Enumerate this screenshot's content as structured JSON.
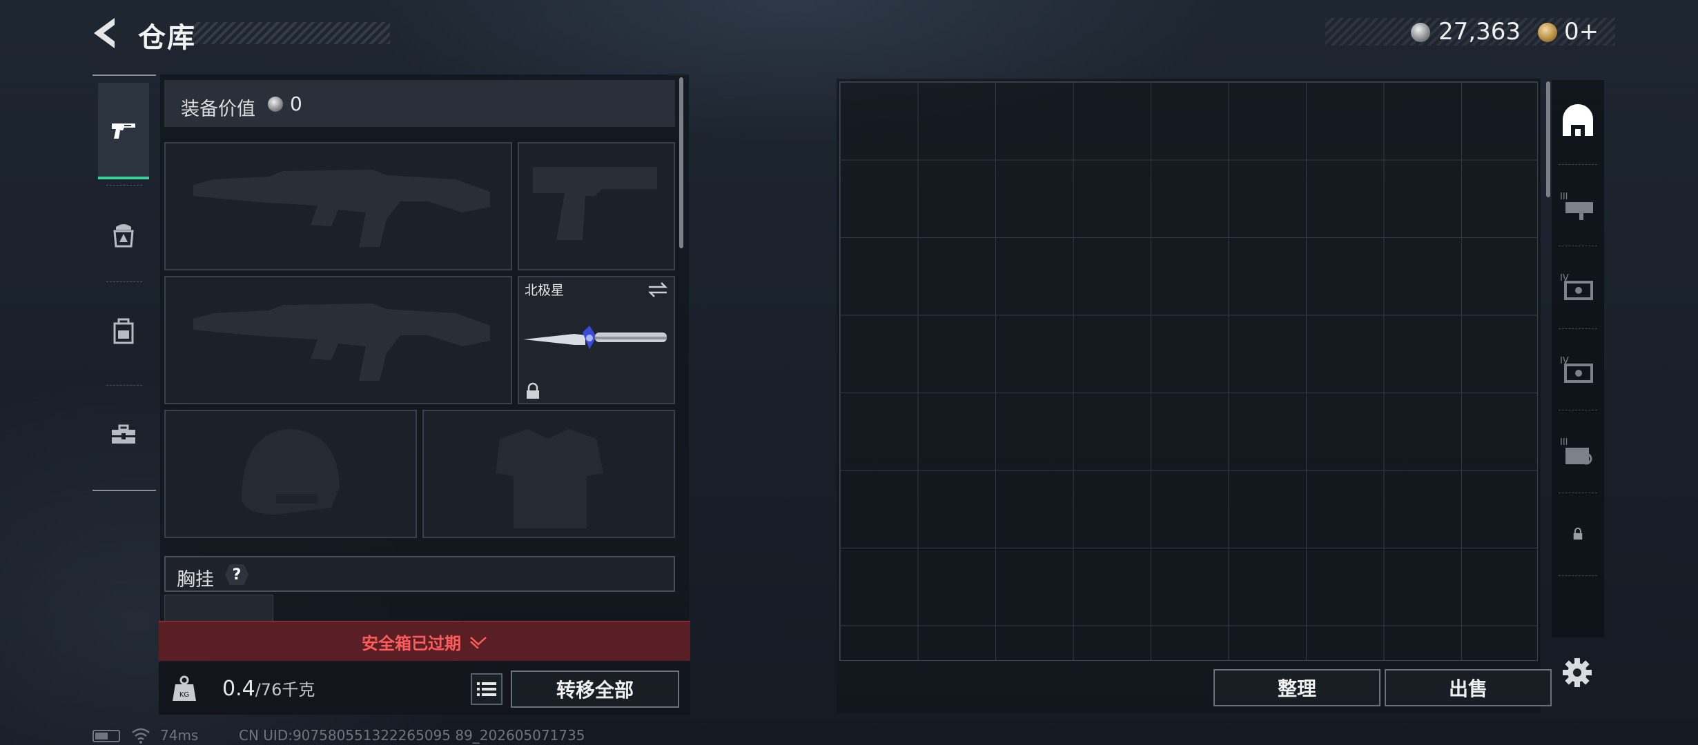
{
  "header": {
    "title": "仓库",
    "currency_silver": "27,363",
    "currency_gold": "0+"
  },
  "categories": [
    {
      "name": "weapons",
      "icon": "pistol-icon",
      "active": true
    },
    {
      "name": "gear",
      "icon": "helmet-armor-icon",
      "active": false
    },
    {
      "name": "backpack",
      "icon": "backpack-icon",
      "active": false
    },
    {
      "name": "toolbox",
      "icon": "toolbox-icon",
      "active": false
    }
  ],
  "equipment": {
    "value_label": "装备价值",
    "value": "0",
    "melee_name": "北极星",
    "chest_rig_label": "胸挂",
    "chest_rig_help": "?",
    "safebox_status": "安全箱已过期",
    "weight_current": "0.4",
    "weight_max": "/76千克",
    "transfer_all": "转移全部"
  },
  "storage": {
    "sort_label": "整理",
    "sell_label": "出售",
    "tabs": [
      {
        "icon": "warehouse-icon",
        "active": true
      },
      {
        "icon": "storage-case-iii-icon",
        "active": false
      },
      {
        "icon": "storage-case-iv-icon",
        "active": false
      },
      {
        "icon": "storage-case-iv-alt-icon",
        "active": false
      },
      {
        "icon": "storage-case-iii-alt-icon",
        "active": false
      },
      {
        "icon": "locked-slot-icon",
        "active": false
      }
    ]
  },
  "status_bar": {
    "ping": "74ms",
    "uid": "CN UID:907580551322265095 89_202605071735"
  },
  "colors": {
    "accent_green": "#3ad09a",
    "warning_red": "#ff5b5b",
    "expired_bg": "#5a1f25"
  }
}
